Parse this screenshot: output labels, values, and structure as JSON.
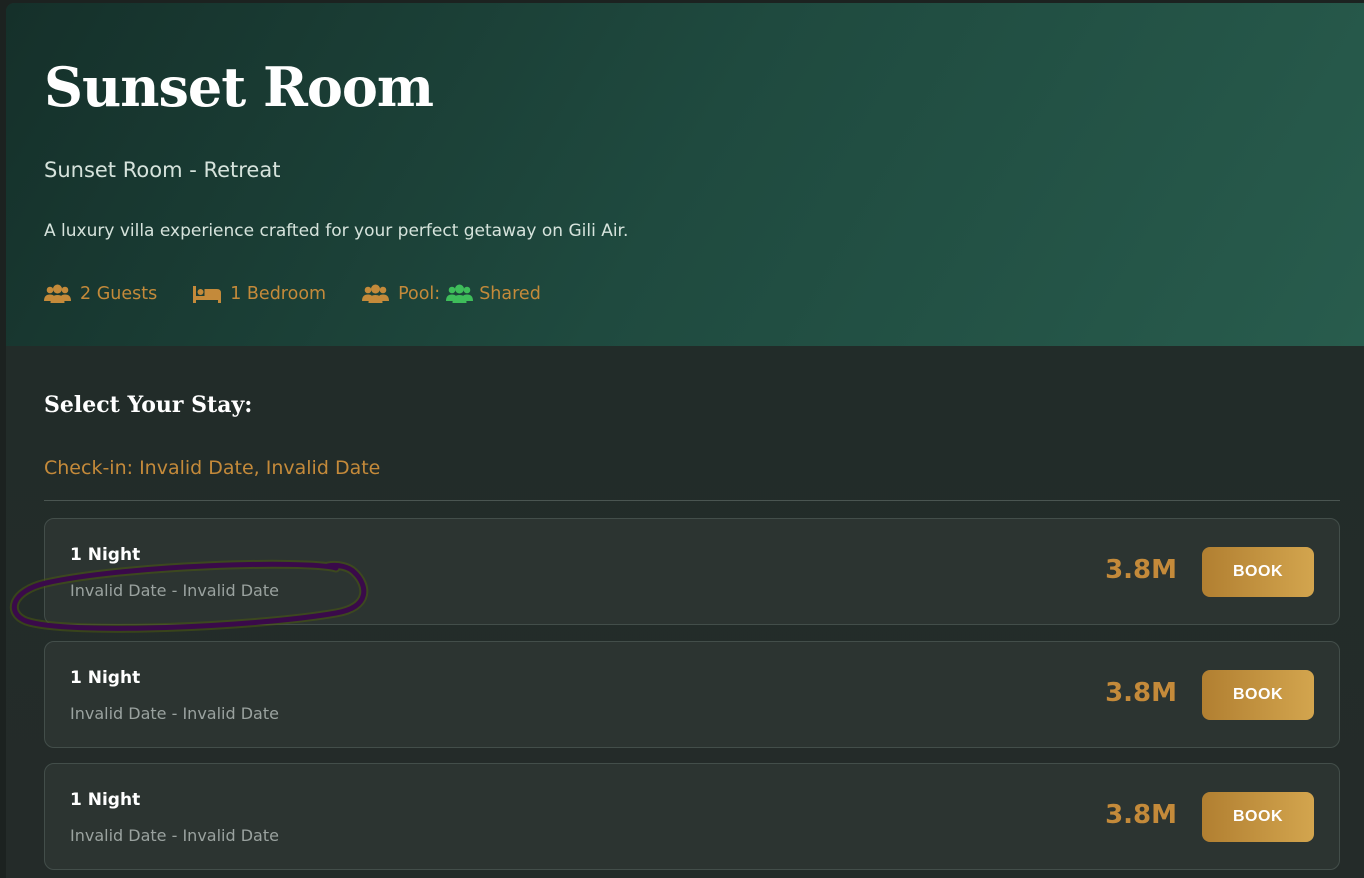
{
  "hero": {
    "title": "Sunset Room",
    "subtitle": "Sunset Room - Retreat",
    "description": "A luxury villa experience crafted for your perfect getaway on Gili Air.",
    "features": {
      "guests": "2 Guests",
      "bedrooms": "1 Bedroom",
      "pool_label": "Pool:",
      "pool_value": "Shared"
    }
  },
  "stay": {
    "title": "Select Your Stay:",
    "checkin": "Check-in: Invalid Date, Invalid Date",
    "options": [
      {
        "name": "1 Night",
        "dates": "Invalid Date - Invalid Date",
        "price": "3.8M",
        "button": "BOOK"
      },
      {
        "name": "1 Night",
        "dates": "Invalid Date - Invalid Date",
        "price": "3.8M",
        "button": "BOOK"
      },
      {
        "name": "1 Night",
        "dates": "Invalid Date - Invalid Date",
        "price": "3.8M",
        "button": "BOOK"
      }
    ]
  },
  "icons": {
    "guests": "users-icon",
    "bedroom": "bed-icon",
    "pool": "users-icon",
    "pool_shared": "users-icon"
  },
  "colors": {
    "accent_gold": "#c48a3a",
    "shared_green": "#3ebd5a",
    "annotation_purple": "#3a0a4a"
  }
}
